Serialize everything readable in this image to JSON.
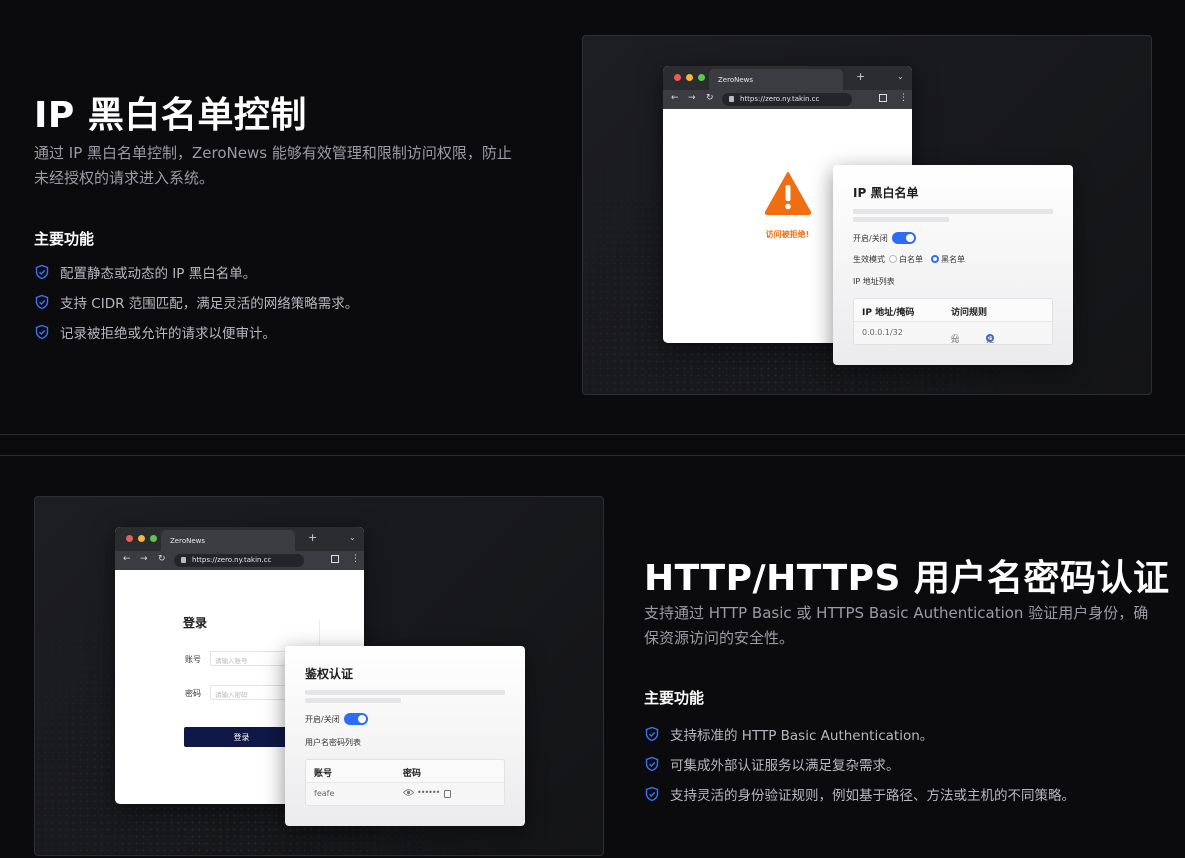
{
  "colors": {
    "accent": "#2f6cf5",
    "warning": "#f06e12",
    "background": "#0b0b0d",
    "login_button": "#0f1846"
  },
  "ip_section": {
    "title": "IP 黑白名单控制",
    "description": [
      "通过 IP 黑白名单控制，ZeroNews 能够有效管理和限制访问权限，防止",
      "未经授权的请求进入系统。"
    ],
    "features_title": "主要功能",
    "features": [
      "配置静态或动态的 IP 黑白名单。",
      "支持 CIDR 范围匹配，满足灵活的网络策略需求。",
      "记录被拒绝或允许的请求以便审计。"
    ],
    "browser": {
      "tab": "ZeroNews",
      "url": "https://zero.ny.takin.cc",
      "denied_text": "访问被拒绝!",
      "icon": "warning-triangle-icon"
    },
    "card": {
      "title": "IP 黑白名单",
      "toggle_label": "开启/关闭",
      "mode_label": "生效模式",
      "mode_options": [
        "白名单",
        "黑名单"
      ],
      "list_label": "IP 地址列表",
      "table_headers": [
        "IP 地址/掩码",
        "访问规则"
      ],
      "row": {
        "ip": "0.0.0.1/32",
        "rules": [
          "允许",
          "拒绝"
        ]
      }
    }
  },
  "auth_section": {
    "title": "HTTP/HTTPS 用户名密码认证",
    "description": [
      "支持通过 HTTP Basic 或 HTTPS Basic Authentication 验证用户身份，确",
      "保资源访问的安全性。"
    ],
    "features_title": "主要功能",
    "features": [
      "支持标准的 HTTP Basic Authentication。",
      "可集成外部认证服务以满足复杂需求。",
      "支持灵活的身份验证规则，例如基于路径、方法或主机的不同策略。"
    ],
    "browser": {
      "tab": "ZeroNews",
      "url": "https://zero.ny.takin.cc",
      "login_title": "登录",
      "account_label": "账号",
      "account_placeholder": "请输入账号",
      "password_label": "密码",
      "password_placeholder": "请输入密码",
      "login_button": "登录"
    },
    "card": {
      "title": "鉴权认证",
      "toggle_label": "开启/关闭",
      "list_label": "用户名密码列表",
      "table_headers": [
        "账号",
        "密码"
      ],
      "row": {
        "account": "feafe",
        "password_mask": "••••••"
      }
    }
  }
}
